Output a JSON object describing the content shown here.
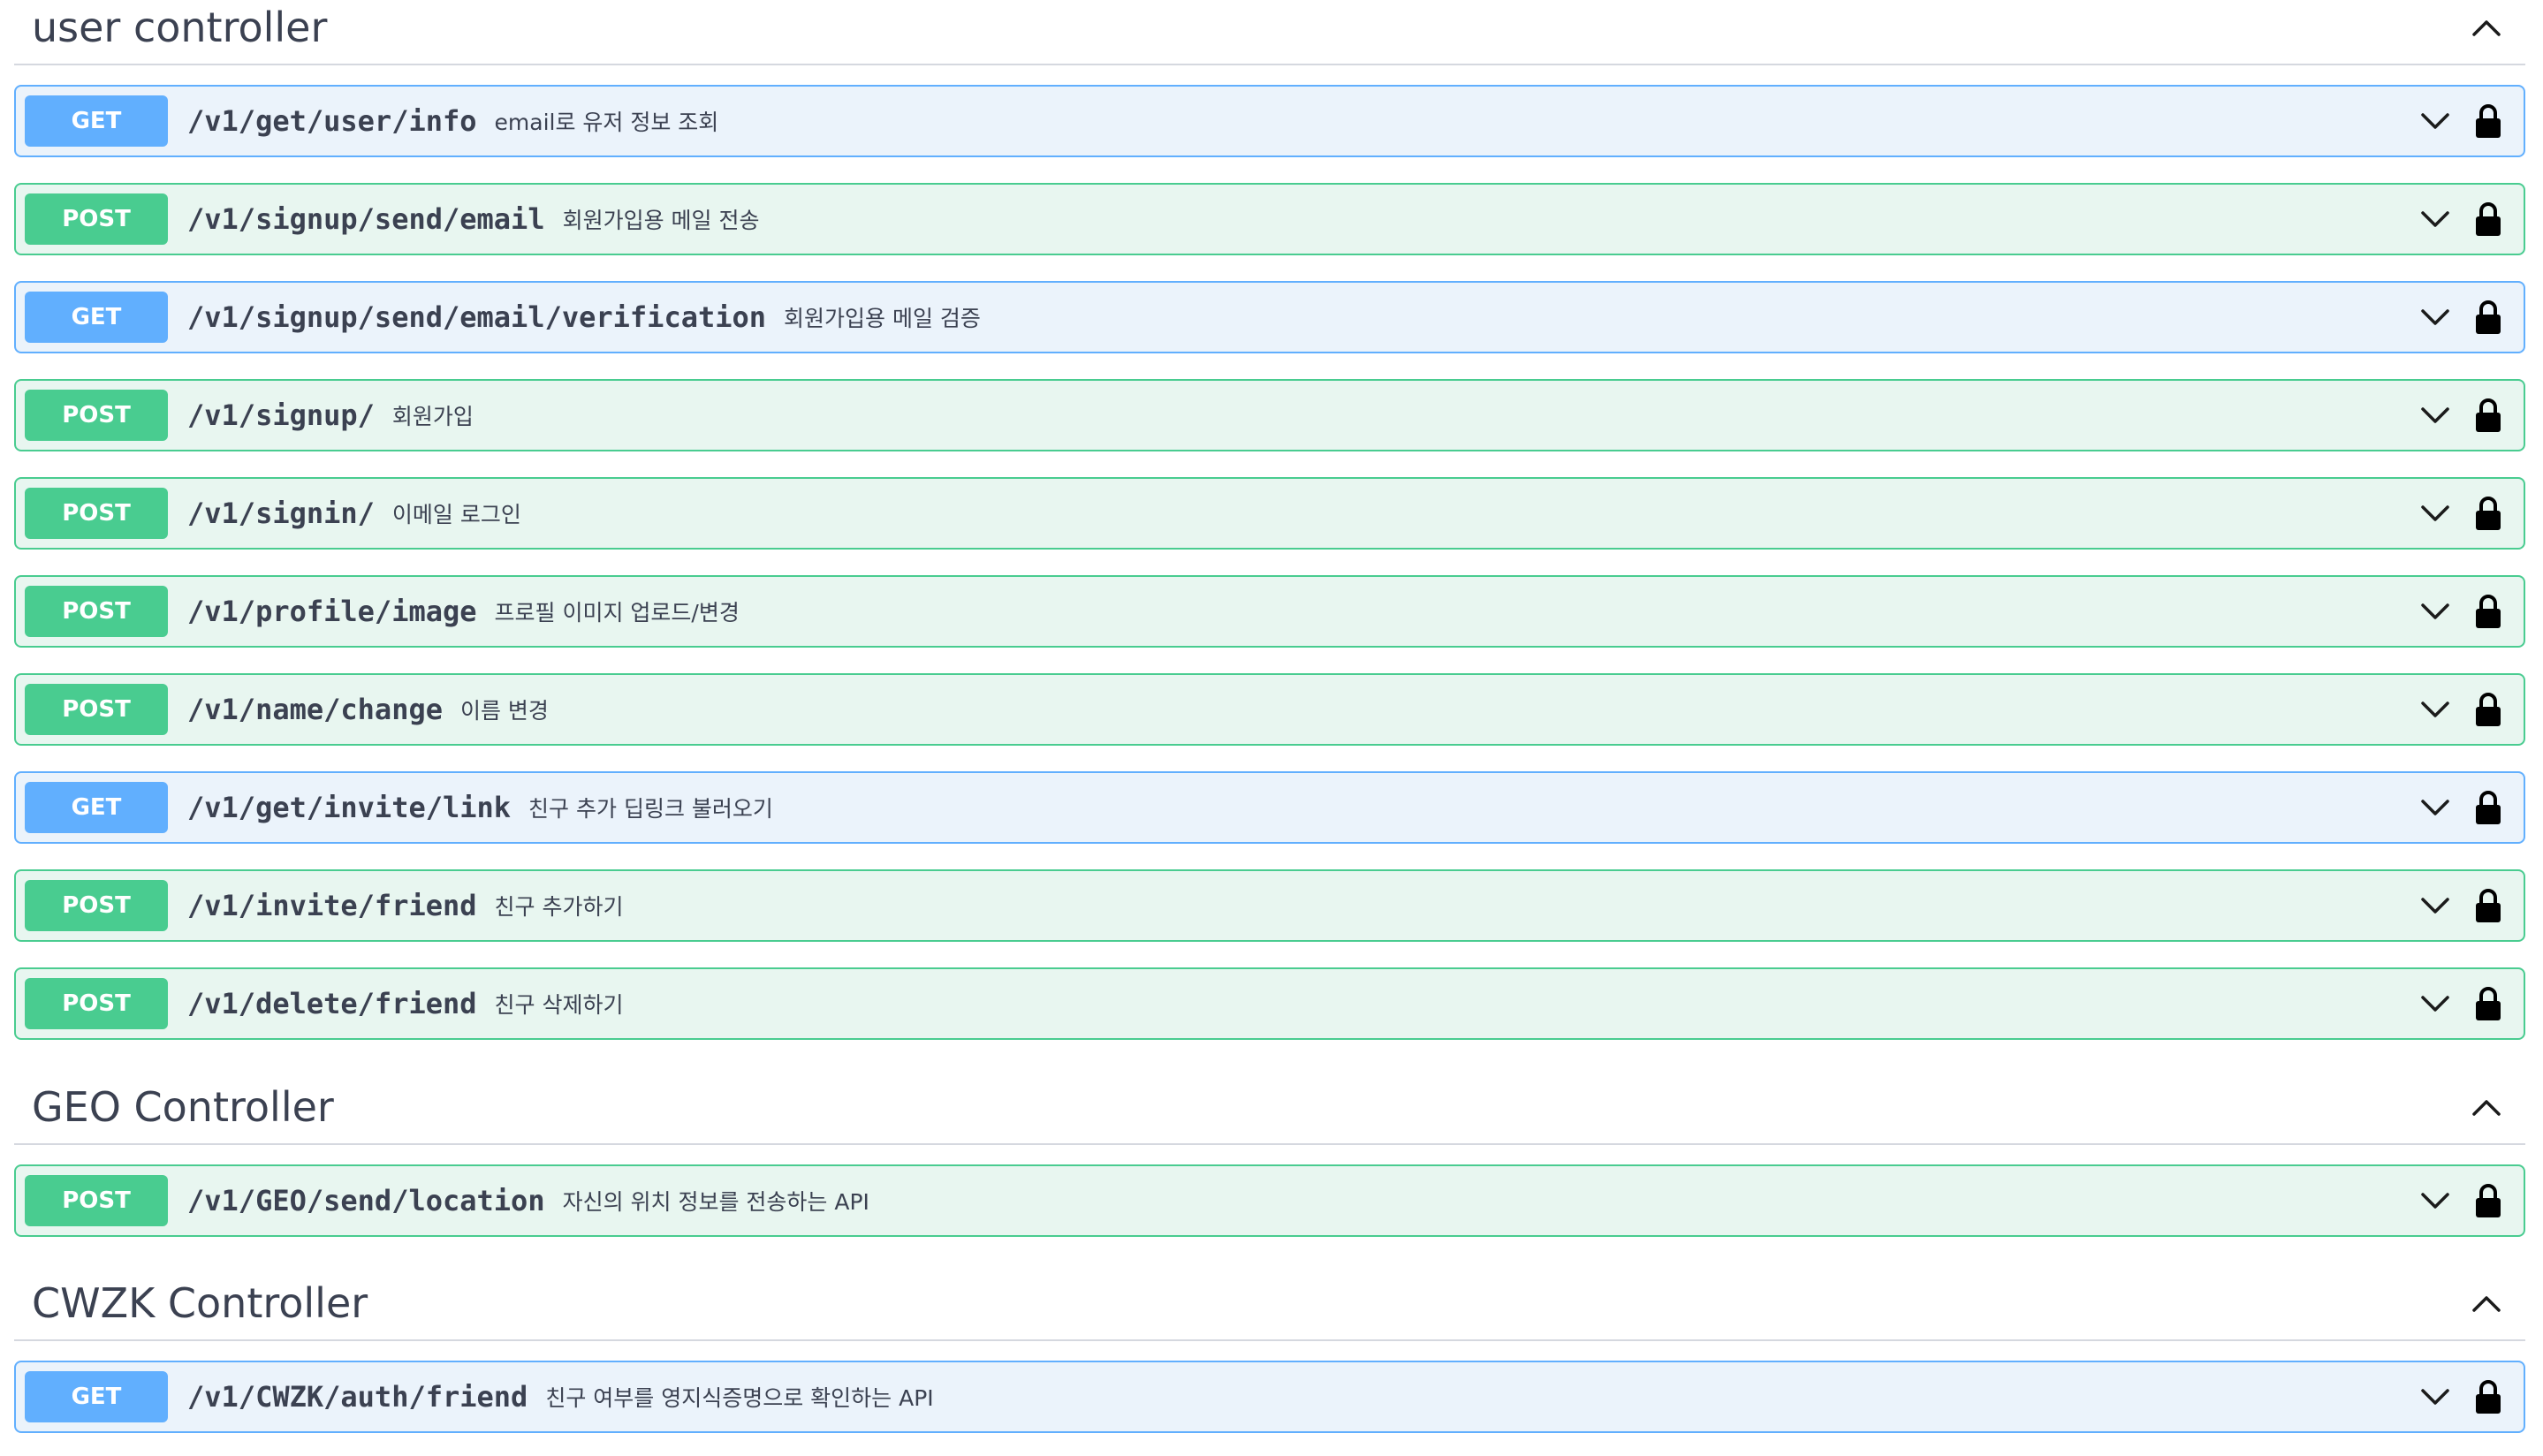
{
  "sections": [
    {
      "title": "user controller",
      "operations": [
        {
          "method": "GET",
          "path": "/v1/get/user/info",
          "description": "email로 유저 정보 조회"
        },
        {
          "method": "POST",
          "path": "/v1/signup/send/email",
          "description": "회원가입용 메일 전송"
        },
        {
          "method": "GET",
          "path": "/v1/signup/send/email/verification",
          "description": "회원가입용 메일 검증"
        },
        {
          "method": "POST",
          "path": "/v1/signup/",
          "description": "회원가입"
        },
        {
          "method": "POST",
          "path": "/v1/signin/",
          "description": "이메일 로그인"
        },
        {
          "method": "POST",
          "path": "/v1/profile/image",
          "description": "프로필 이미지 업로드/변경"
        },
        {
          "method": "POST",
          "path": "/v1/name/change",
          "description": "이름 변경"
        },
        {
          "method": "GET",
          "path": "/v1/get/invite/link",
          "description": "친구 추가 딥링크 불러오기"
        },
        {
          "method": "POST",
          "path": "/v1/invite/friend",
          "description": "친구 추가하기"
        },
        {
          "method": "POST",
          "path": "/v1/delete/friend",
          "description": "친구 삭제하기"
        }
      ]
    },
    {
      "title": "GEO Controller",
      "operations": [
        {
          "method": "POST",
          "path": "/v1/GEO/send/location",
          "description": "자신의 위치 정보를 전송하는 API"
        }
      ]
    },
    {
      "title": "CWZK Controller",
      "operations": [
        {
          "method": "GET",
          "path": "/v1/CWZK/auth/friend",
          "description": "친구 여부를 영지식증명으로 확인하는 API"
        }
      ]
    }
  ],
  "icons": {
    "section_toggle": "chevron-up-icon",
    "operation_expand": "chevron-down-icon",
    "auth": "lock-icon"
  },
  "colors": {
    "get_accent": "#61affe",
    "get_background": "#ebf3fb",
    "post_accent": "#49cc90",
    "post_background": "#e8f6f0",
    "text": "#3b4151"
  }
}
